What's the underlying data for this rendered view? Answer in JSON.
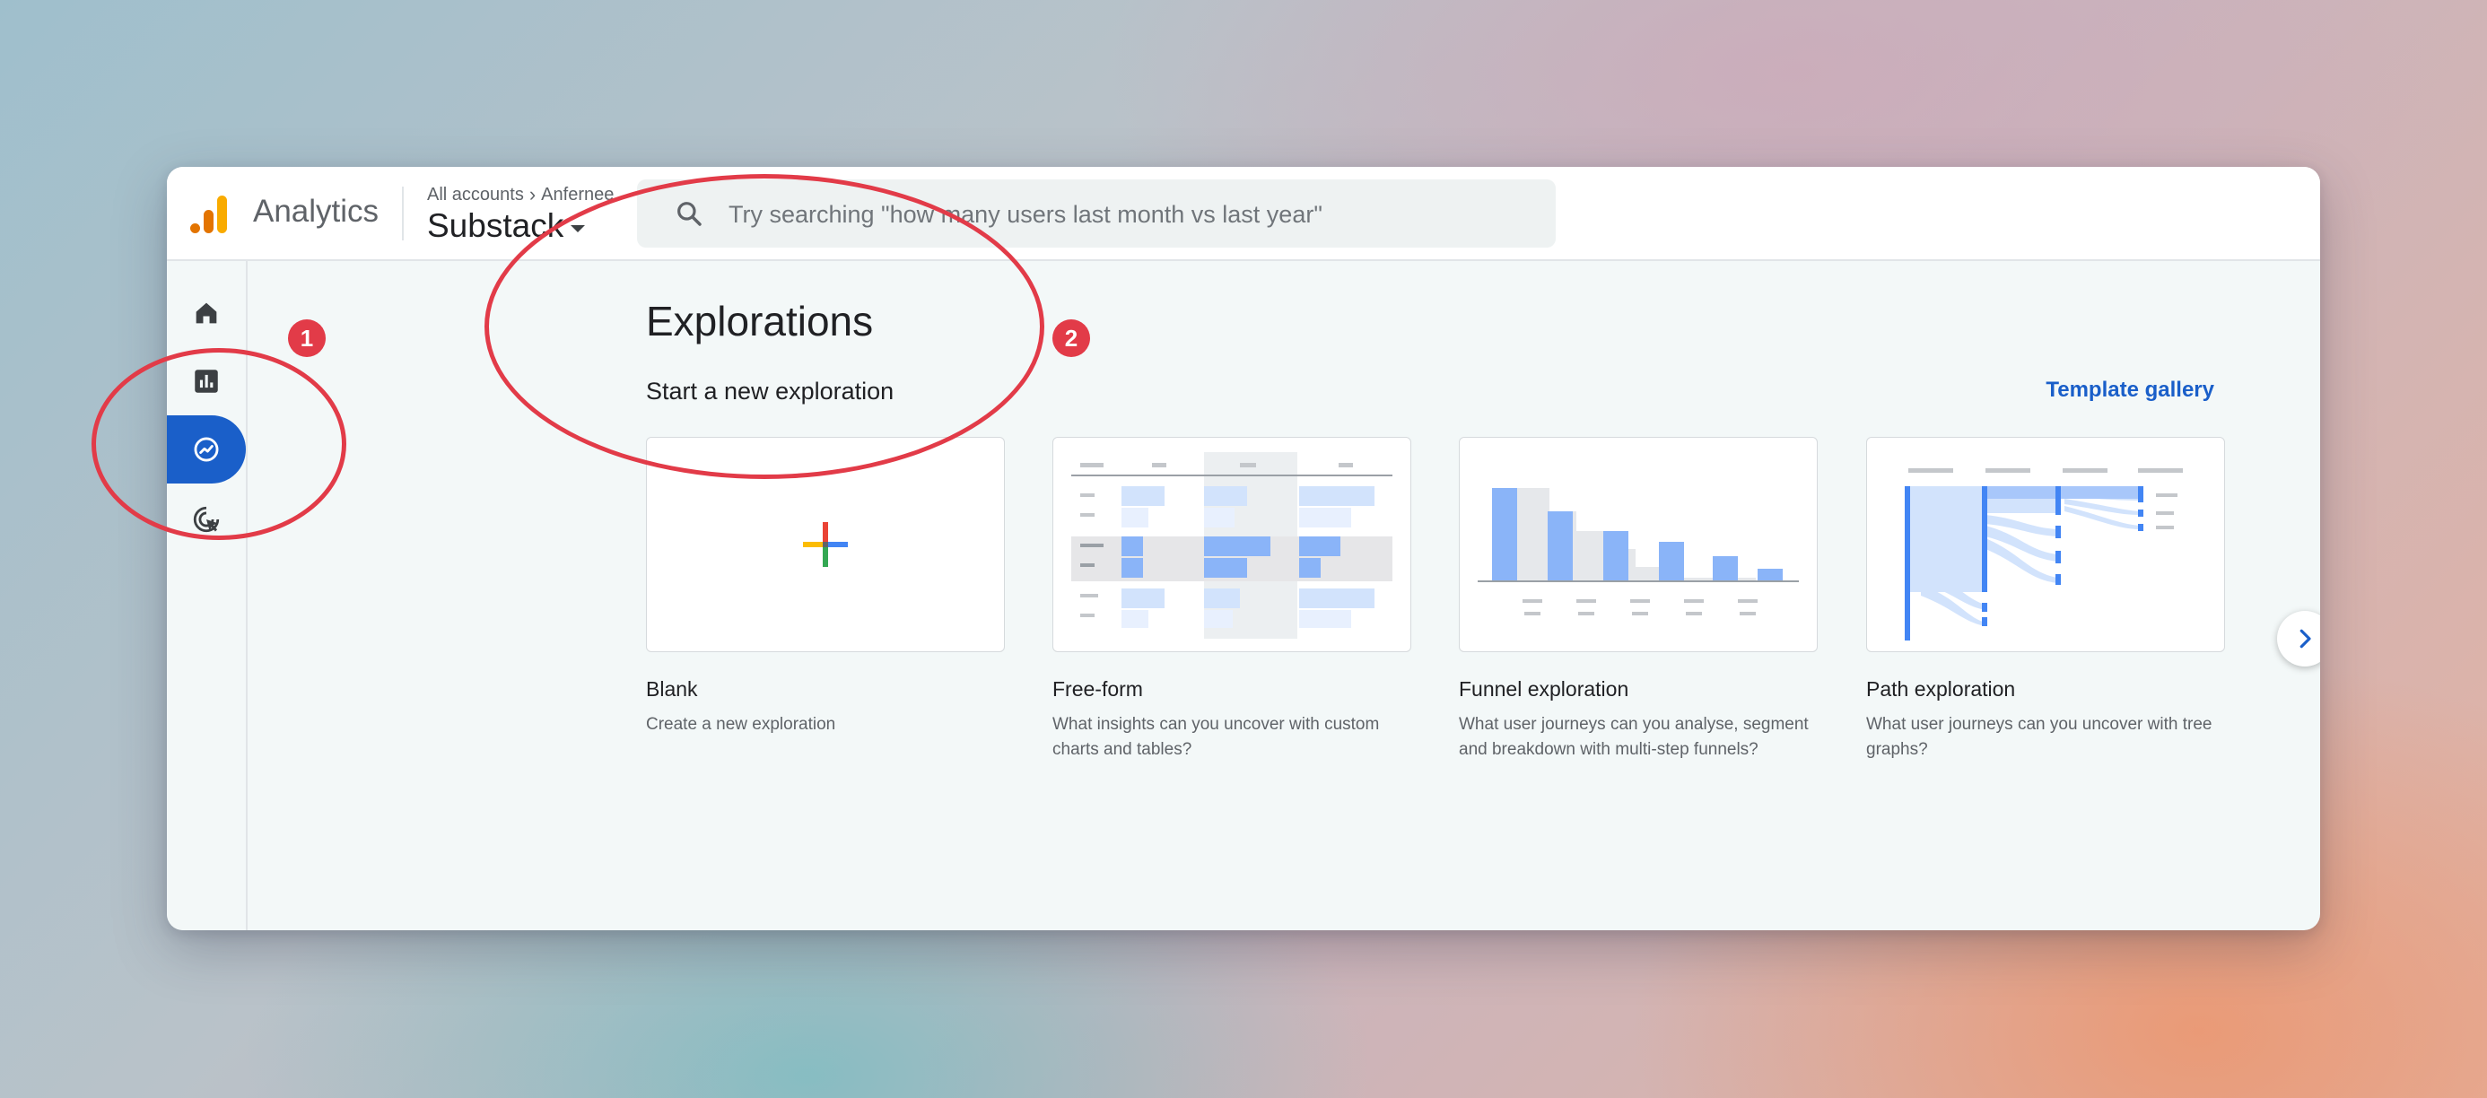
{
  "app": {
    "name": "Analytics"
  },
  "breadcrumb": {
    "accounts": "All accounts",
    "account": "Anfernee"
  },
  "property": {
    "name": "Substack"
  },
  "search": {
    "placeholder": "Try searching \"how many users last month vs last year\""
  },
  "sidebar": {
    "items": [
      {
        "icon": "home-icon"
      },
      {
        "icon": "reports-icon"
      },
      {
        "icon": "explore-icon",
        "active": true
      },
      {
        "icon": "advertising-icon"
      }
    ]
  },
  "page": {
    "title": "Explorations",
    "subtitle": "Start a new exploration",
    "template_gallery": "Template gallery"
  },
  "cards": [
    {
      "title": "Blank",
      "description": "Create a new exploration"
    },
    {
      "title": "Free-form",
      "description": "What insights can you uncover with custom charts and tables?"
    },
    {
      "title": "Funnel exploration",
      "description": "What user journeys can you analyse, segment and breakdown with multi-step funnels?"
    },
    {
      "title": "Path exploration",
      "description": "What user journeys can you uncover with tree graphs?"
    }
  ],
  "annotations": [
    {
      "label": "1"
    },
    {
      "label": "2"
    }
  ],
  "colors": {
    "accent": "#1a5fc9",
    "annotation": "#e23b48",
    "chart_blue": "#8ab4f8"
  }
}
